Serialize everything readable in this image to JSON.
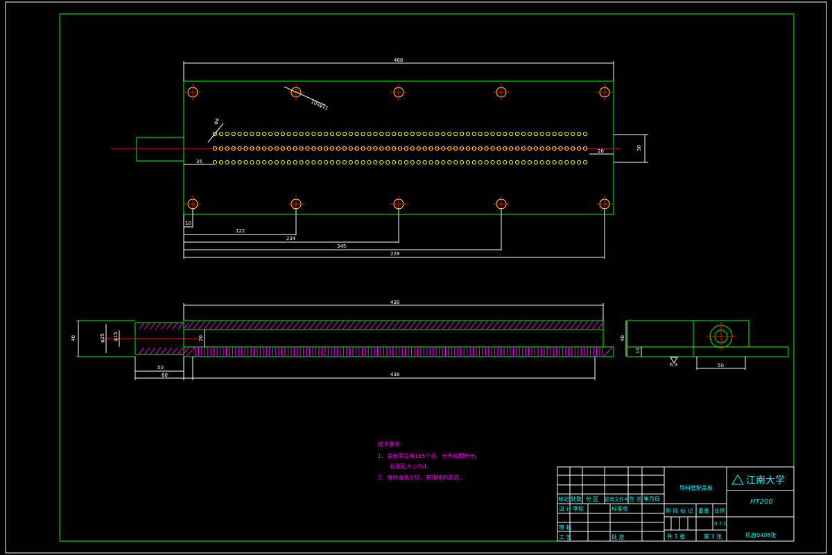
{
  "dimensions": {
    "top_overall": "468",
    "angled_label": "10xφ11",
    "hole_pitch": "φ4",
    "right_offset": "28",
    "right_height": "30",
    "left_offset": "35",
    "chain_10": "10",
    "chain_122": "122",
    "chain_234": "234",
    "chain_345": "345",
    "chain_228": "228",
    "section_top": "438",
    "section_bottom": "438",
    "height_40": "40",
    "dia_25": "φ25",
    "dia_15": "φ15",
    "inner_20": "20",
    "len_50": "50",
    "len_60": "60",
    "side_height": "40",
    "side_10": "10",
    "side_width": "50",
    "roughness": "6.3"
  },
  "notes": {
    "title": "技术要求：",
    "line1": "1、盖板需钻有165个孔，分布如图所示。",
    "line2": "孔距孔大小为4。",
    "line3": "2、棱体由激光切，有锐棱倒圆或。"
  },
  "title_block": {
    "part_name": "导料管配盖板",
    "university": "江南大学",
    "material": "HT200",
    "scale": "0.7:1",
    "drawing_no": "机自0408张",
    "sheet_total": "共 1 张",
    "sheet_no": "第 1 张",
    "hdr_mark": "标记",
    "hdr_count": "处数",
    "hdr_zone": "分 区",
    "hdr_docno": "更改文件号",
    "hdr_sign": "签 名",
    "hdr_date": "年月日",
    "design": "设 计",
    "designer": "李姣",
    "standardize": "标准化",
    "review": "审 核",
    "process": "工 艺",
    "approve": "批 准",
    "stage_mark": "阶 段 标 记",
    "weight": "重量",
    "scale_label": "比例"
  }
}
